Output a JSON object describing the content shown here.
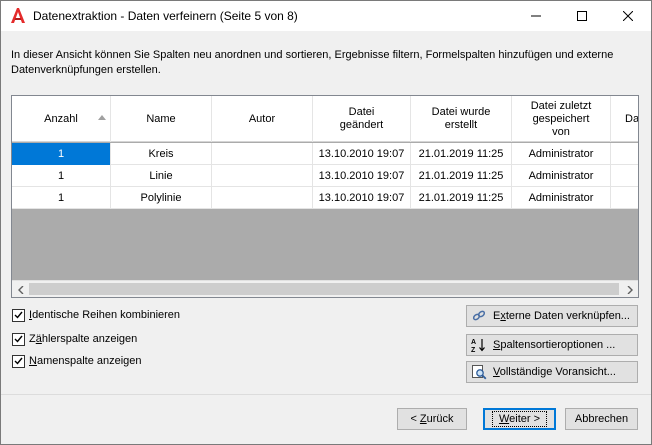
{
  "window": {
    "title": "Datenextraktion - Daten verfeinern (Seite 5 von 8)",
    "icon": "autocad-logo-icon",
    "brand_color": "#e52b2b"
  },
  "description": "In dieser Ansicht können Sie Spalten neu anordnen und sortieren, Ergebnisse filtern, Formelspalten hinzufügen und externe Datenverknüpfungen erstellen.",
  "grid": {
    "columns": [
      {
        "label": "Anzahl",
        "sorted": "ascending"
      },
      {
        "label": "Name"
      },
      {
        "label": "Autor"
      },
      {
        "label": "Datei\ngeändert"
      },
      {
        "label": "Datei wurde\nerstellt"
      },
      {
        "label": "Datei zuletzt\ngespeichert\nvon"
      },
      {
        "label": "Da"
      }
    ],
    "rows": [
      {
        "anzahl": "1",
        "name": "Kreis",
        "autor": "",
        "geaendert": "13.10.2010 19:07",
        "erstellt": "21.01.2019 11:25",
        "gespeichert": "Administrator",
        "selected_col": "anzahl"
      },
      {
        "anzahl": "1",
        "name": "Linie",
        "autor": "",
        "geaendert": "13.10.2010 19:07",
        "erstellt": "21.01.2019 11:25",
        "gespeichert": "Administrator"
      },
      {
        "anzahl": "1",
        "name": "Polylinie",
        "autor": "",
        "geaendert": "13.10.2010 19:07",
        "erstellt": "21.01.2019 11:25",
        "gespeichert": "Administrator"
      }
    ],
    "selection_color": "#0078d7"
  },
  "options": {
    "combine": {
      "label_u": "I",
      "label_rest": "dentische Reihen kombinieren",
      "checked": true
    },
    "counter": {
      "label_pre": "Z",
      "label_u": "ä",
      "label_rest": "hlerspalte anzeigen",
      "checked": true
    },
    "names": {
      "label_pre": "",
      "label_u": "N",
      "label_rest": "amenspalte anzeigen",
      "checked": true
    }
  },
  "side_buttons": {
    "link": {
      "label_pre": "E",
      "label_u": "x",
      "label_rest": "terne Daten verknüpfen...",
      "icon": "link-chain-icon"
    },
    "sort": {
      "label_pre": "",
      "label_u": "S",
      "label_rest": "paltensortieroptionen ...",
      "icon": "sort-az-icon"
    },
    "preview": {
      "label_pre": "",
      "label_u": "V",
      "label_rest": "ollständige Voransicht...",
      "icon": "magnifier-preview-icon"
    }
  },
  "footer": {
    "back": {
      "label_pre": "< ",
      "label_u": "Z",
      "label_rest": "urück"
    },
    "next": {
      "label_pre": "",
      "label_u": "W",
      "label_rest": "eiter >"
    },
    "cancel": "Abbrechen"
  }
}
